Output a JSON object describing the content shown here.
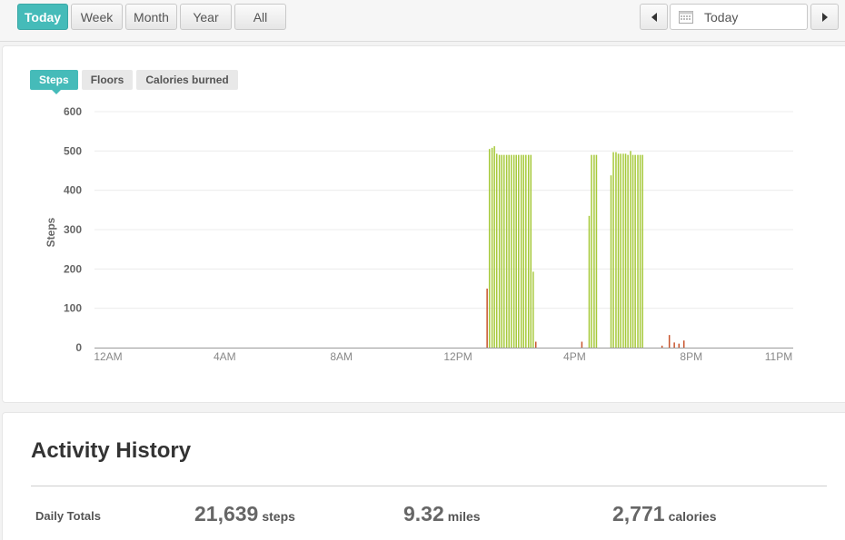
{
  "range_buttons": [
    {
      "label": "Today",
      "active": true
    },
    {
      "label": "Week",
      "active": false
    },
    {
      "label": "Month",
      "active": false
    },
    {
      "label": "Year",
      "active": false
    },
    {
      "label": "All",
      "active": false
    }
  ],
  "date_picker": {
    "label": "Today",
    "prev_icon": "caret-left-icon",
    "next_icon": "caret-right-icon",
    "calendar_icon": "calendar-icon"
  },
  "metric_tabs": [
    {
      "label": "Steps",
      "active": true
    },
    {
      "label": "Floors",
      "active": false
    },
    {
      "label": "Calories burned",
      "active": false
    }
  ],
  "colors": {
    "accent": "#45bbb9",
    "active_bar": "#a6c93a",
    "light_bar": "#c8542c"
  },
  "chart_data": {
    "type": "bar",
    "ylabel": "Steps",
    "xlabel": "",
    "ylim": [
      0,
      600
    ],
    "yticks": [
      "600",
      "500",
      "400",
      "300",
      "200",
      "100",
      "0"
    ],
    "ytick_values": [
      600,
      500,
      400,
      300,
      200,
      100,
      0
    ],
    "xticks": [
      "12AM",
      "4AM",
      "8AM",
      "12PM",
      "4PM",
      "8PM",
      "11PM"
    ],
    "xtick_hours": [
      0,
      4,
      8,
      12,
      16,
      20,
      23
    ],
    "x_unit": "hours since midnight",
    "xlim": [
      0,
      24
    ],
    "grid": true,
    "series": [
      {
        "color": "#a6c93a",
        "x": [
          13.08,
          13.17,
          13.25,
          13.33,
          13.42,
          13.5,
          13.58,
          13.67,
          13.75,
          13.83,
          13.92,
          14.0,
          14.08,
          14.17,
          14.25,
          14.33,
          14.42,
          14.5,
          14.58,
          16.5,
          16.58,
          16.67,
          16.75,
          17.25,
          17.33,
          17.42,
          17.5,
          17.58,
          17.67,
          17.75,
          17.83,
          17.92,
          18.0,
          18.08,
          18.17,
          18.25,
          18.33
        ],
        "values": [
          505,
          508,
          512,
          493,
          490,
          490,
          490,
          490,
          490,
          490,
          490,
          490,
          490,
          490,
          490,
          490,
          490,
          490,
          193,
          335,
          490,
          490,
          490,
          438,
          497,
          497,
          493,
          493,
          493,
          493,
          490,
          500,
          490,
          490,
          490,
          490,
          490
        ]
      },
      {
        "color": "#c8542c",
        "x": [
          13.0,
          14.67,
          16.25,
          19.0,
          19.25,
          19.42,
          19.58,
          19.75
        ],
        "values": [
          150,
          15,
          15,
          5,
          32,
          13,
          10,
          18
        ]
      }
    ]
  },
  "history": {
    "title": "Activity History",
    "daily_totals_label": "Daily Totals",
    "totals": [
      {
        "value": "21,639",
        "unit": "steps"
      },
      {
        "value": "9.32",
        "unit": "miles"
      },
      {
        "value": "2,771",
        "unit": "calories"
      }
    ]
  }
}
